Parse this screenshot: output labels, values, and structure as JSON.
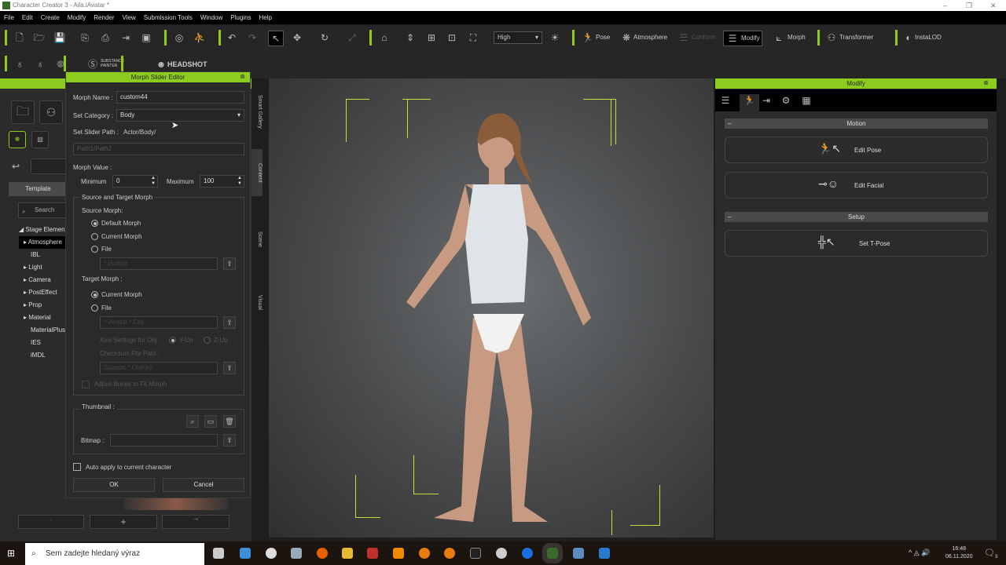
{
  "window": {
    "title": "Character Creator 3 - Aila.iAvatar *"
  },
  "menu": [
    "File",
    "Edit",
    "Create",
    "Modify",
    "Render",
    "View",
    "Submission Tools",
    "Window",
    "Plugins",
    "Help"
  ],
  "toolbar": {
    "quality": "High",
    "pose": "Pose",
    "atmosphere": "Atmosphere",
    "conform": "Conform",
    "modify": "Modify",
    "morph": "Morph",
    "transformer": "Transformer",
    "instalod": "InstaLOD",
    "substance_line1": "SUBSTANCE",
    "substance_line2": "PAINTER",
    "headshot": "HEADSHOT"
  },
  "left_panel": {
    "template_tab": "Template",
    "search_placeholder": "Search",
    "tree": [
      "Stage Elements",
      "Atmosphere",
      "IBL",
      "Light",
      "Camera",
      "PostEffect",
      "Prop",
      "Material",
      "MaterialPlus",
      "IES",
      "iMDL"
    ]
  },
  "side_tabs": [
    "Smart Gallery",
    "Content",
    "Scene",
    "Visual"
  ],
  "dialog": {
    "title": "Morph Slider Editor",
    "morph_name_label": "Morph Name :",
    "morph_name": "custom44",
    "category_label": "Set Category :",
    "category": "Body",
    "slider_path_label": "Set Slider Path :",
    "slider_path": "Actor/Body/",
    "path_placeholder": "Path1/Path2",
    "morph_value_label": "Morph Value :",
    "minimum_label": "Minimum",
    "minimum": "0",
    "maximum_label": "Maximum",
    "maximum": "100",
    "source_target_label": "Source and Target Morph",
    "source_label": "Source Morph:",
    "source_options": [
      "Default Morph",
      "Current Morph",
      "File"
    ],
    "source_file_placeholder": "*.iAvatar",
    "target_label": "Target Morph :",
    "target_options": [
      "Current Morph",
      "File"
    ],
    "target_file_placeholder": "*.iAvatar *.Obj",
    "axis_label": "Axis Settings for Obj",
    "axis_yup": "Y-Up",
    "axis_zup": "Z-Up",
    "checksum_label": "Checksum File Path :",
    "checksum_placeholder": "Support *.ObjKey",
    "adjust_bones": "Adjust Bones to Fit Morph",
    "thumbnail_label": "Thumbnail :",
    "bitmap_label": "Bitmap :",
    "auto_apply": "Auto apply to current character",
    "ok": "OK",
    "cancel": "Cancel"
  },
  "right_panel": {
    "title": "Modify",
    "motion_section": "Motion",
    "edit_pose": "Edit Pose",
    "edit_facial": "Edit Facial",
    "setup_section": "Setup",
    "set_tpose": "Set T-Pose"
  },
  "taskbar": {
    "search_placeholder": "Sem zadejte hledaný výraz",
    "time": "16:48",
    "date": "06.11.2020",
    "notifications": "3"
  },
  "colors": {
    "accent": "#8ccc1e",
    "bracket": "#c8dc3c"
  }
}
